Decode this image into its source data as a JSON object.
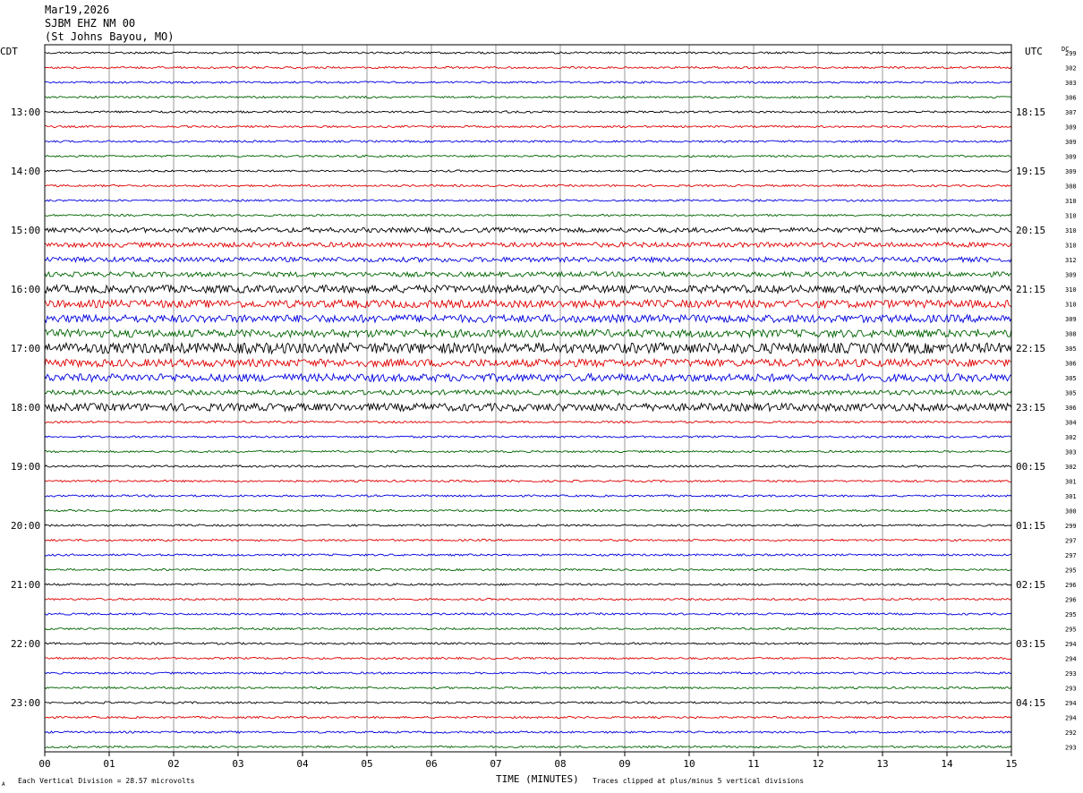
{
  "header": {
    "date": "Mar19,2026",
    "station": "SJBM EHZ NM 00",
    "location": "(St Johns Bayou, MO)"
  },
  "left_label": "CDT",
  "right_label": "UTC",
  "dc_label": "DC",
  "footer": {
    "scale_note": "Each Vertical Division =   28.57 microvolts",
    "clip_note": "Traces clipped at plus/minus 5 vertical divisions",
    "corner_mark": "A"
  },
  "chart_data": {
    "type": "line",
    "title": "",
    "xlabel": "TIME (MINUTES)",
    "ylabel": "",
    "xlim": [
      0,
      15
    ],
    "x_ticks": [
      "00",
      "01",
      "02",
      "03",
      "04",
      "05",
      "06",
      "07",
      "08",
      "09",
      "10",
      "11",
      "12",
      "13",
      "14",
      "15"
    ],
    "left_hour_labels": [
      "13:00",
      "14:00",
      "15:00",
      "16:00",
      "17:00",
      "18:00",
      "19:00",
      "20:00",
      "21:00",
      "22:00",
      "23:00"
    ],
    "right_hour_labels": [
      "18:15",
      "19:15",
      "20:15",
      "21:15",
      "22:15",
      "23:15",
      "00:15",
      "01:15",
      "02:15",
      "03:15",
      "04:15"
    ],
    "trace_colors": [
      "#000000",
      "#e00000",
      "#0000e0",
      "#006400"
    ],
    "dc_offsets": [
      299,
      302,
      303,
      306,
      307,
      309,
      309,
      309,
      309,
      308,
      310,
      310,
      310,
      310,
      312,
      309,
      310,
      310,
      309,
      308,
      305,
      306,
      305,
      305,
      306,
      304,
      302,
      303,
      302,
      301,
      301,
      300,
      299,
      297,
      297,
      295,
      296,
      296,
      295,
      295,
      294,
      294,
      293,
      293,
      294,
      294,
      292,
      293
    ],
    "trace_count": 48,
    "amplitude_levels": [
      1,
      1,
      1,
      1,
      1,
      1,
      1,
      1,
      1,
      1,
      1,
      1,
      2,
      2,
      2,
      2,
      3,
      3,
      3,
      3,
      4,
      3,
      3,
      2,
      3,
      1,
      1,
      1,
      1,
      1,
      1,
      1,
      1,
      1,
      1,
      1,
      1,
      1,
      1,
      1,
      1,
      1,
      1,
      1,
      1,
      1,
      1,
      1
    ],
    "grid": "vertical-minute-lines"
  }
}
